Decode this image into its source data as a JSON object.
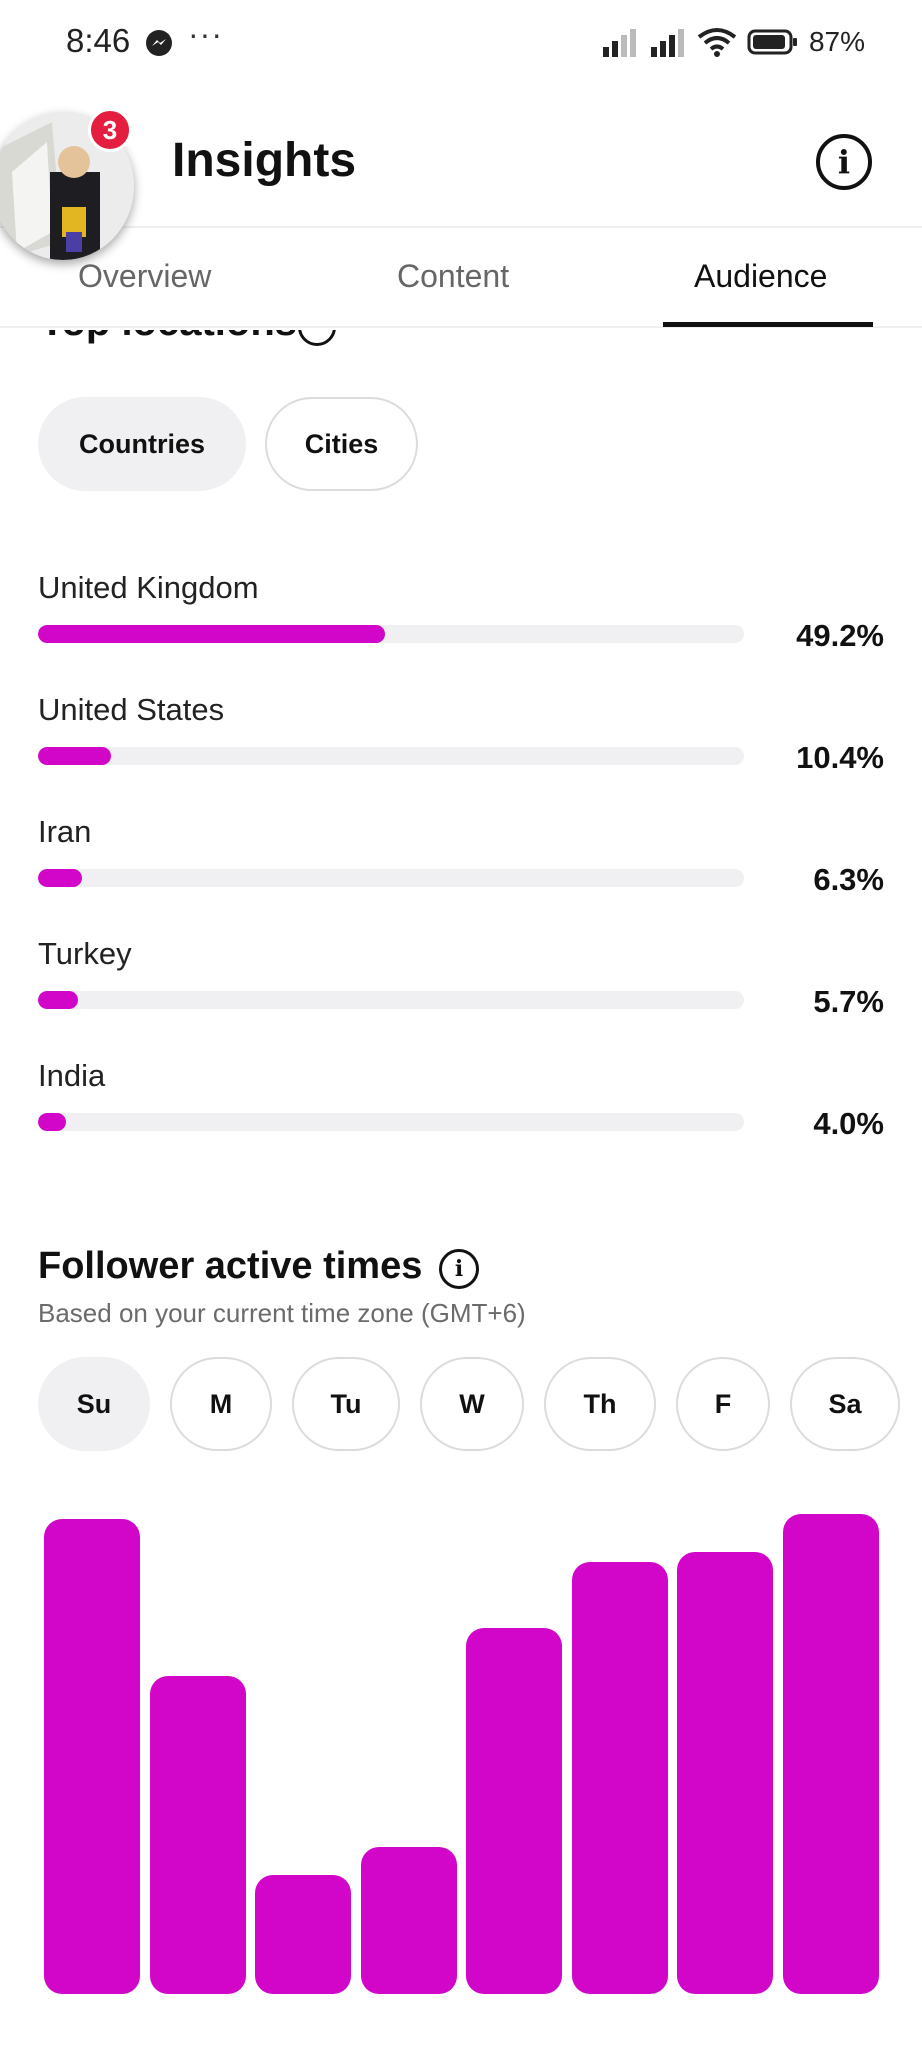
{
  "status_bar": {
    "time": "8:46",
    "dots": "···",
    "battery_pct": "87%",
    "icons": [
      "messenger-icon",
      "signal-icon",
      "signal-icon",
      "wifi-icon",
      "battery-icon"
    ]
  },
  "header": {
    "title": "Insights",
    "badge_count": "3",
    "info_glyph": "i"
  },
  "tabs": [
    {
      "label": "Overview"
    },
    {
      "label": "Content"
    },
    {
      "label": "Audience"
    }
  ],
  "active_tab": "Audience",
  "top_locations": {
    "title": "Top locations",
    "filters": [
      "Countries",
      "Cities"
    ],
    "active_filter": "Countries",
    "items": [
      {
        "name": "United Kingdom",
        "pct_label": "49.2%",
        "value": 49.2
      },
      {
        "name": "United States",
        "pct_label": "10.4%",
        "value": 10.4
      },
      {
        "name": "Iran",
        "pct_label": "6.3%",
        "value": 6.3
      },
      {
        "name": "Turkey",
        "pct_label": "5.7%",
        "value": 5.7
      },
      {
        "name": "India",
        "pct_label": "4.0%",
        "value": 4.0
      }
    ]
  },
  "active_times": {
    "title": "Follower active times",
    "info_glyph": "i",
    "subtitle": "Based on your current time zone (GMT+6)",
    "days": [
      "Su",
      "M",
      "Tu",
      "W",
      "Th",
      "F",
      "Sa"
    ],
    "active_day": "Su"
  },
  "chart_data": {
    "type": "bar",
    "categories": [
      "bar-1",
      "bar-2",
      "bar-3",
      "bar-4",
      "bar-5",
      "bar-6",
      "bar-7",
      "bar-8"
    ],
    "values": [
      100,
      67,
      25,
      31,
      77,
      91,
      93,
      101
    ],
    "note": "Relative heights only; no axis or values are printed."
  },
  "colors": {
    "accent": "#d106c8",
    "track": "#f0f0f2",
    "badge": "#e41e3f"
  }
}
